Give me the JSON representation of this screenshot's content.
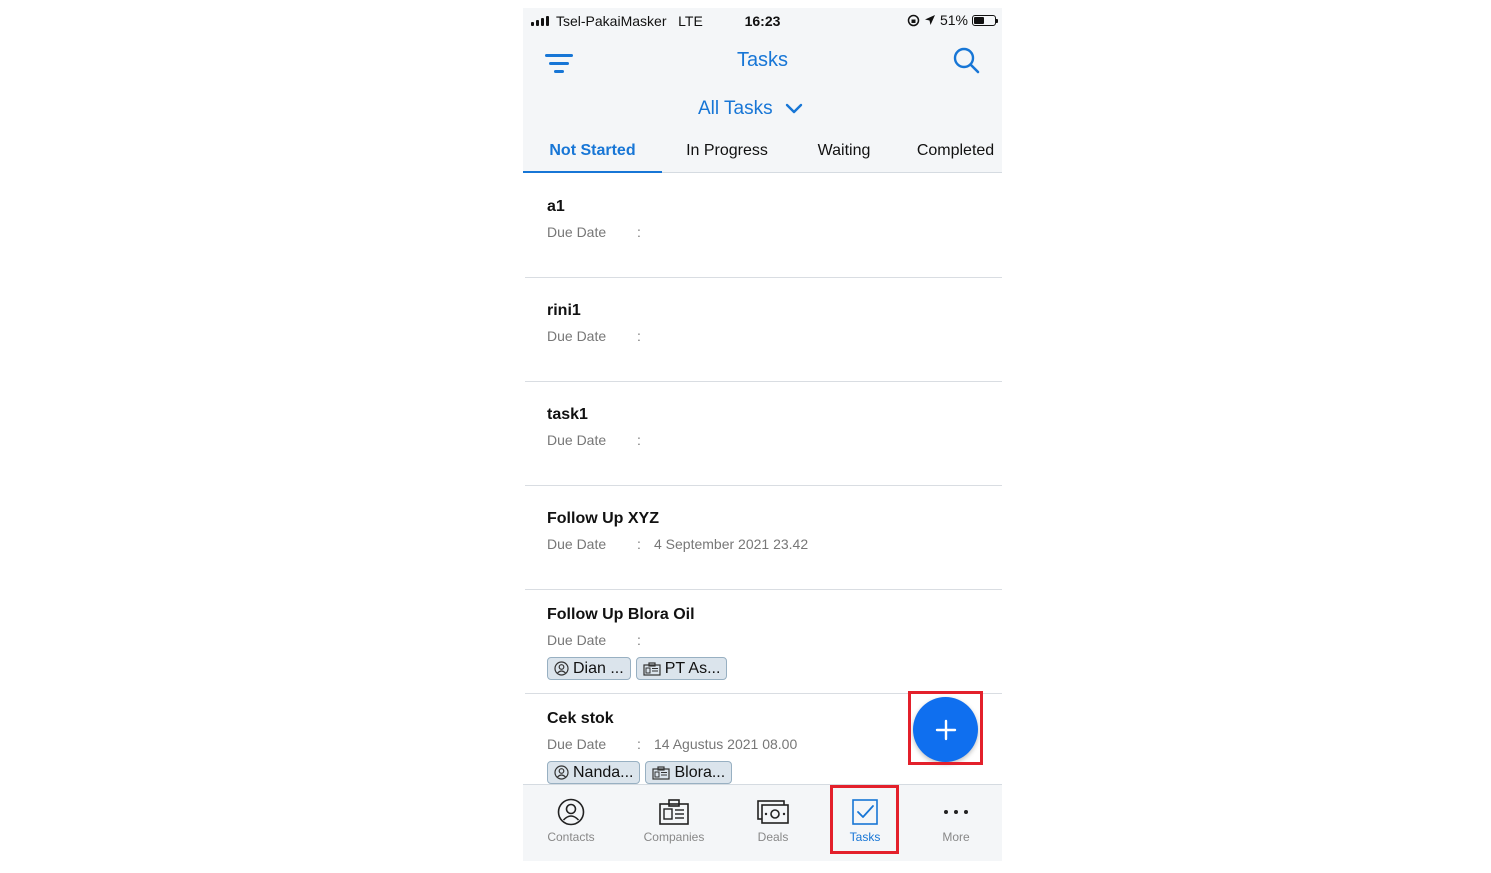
{
  "status_bar": {
    "carrier": "Tsel-PakaiMasker",
    "network": "LTE",
    "time": "16:23",
    "battery": "51%",
    "battery_level": 0.51
  },
  "header": {
    "title": "Tasks",
    "view_selector": "All Tasks",
    "accent_color": "#1776d6"
  },
  "tabs": [
    {
      "label": "Not Started",
      "active": true
    },
    {
      "label": "In Progress",
      "active": false
    },
    {
      "label": "Waiting",
      "active": false
    },
    {
      "label": "Completed",
      "active": false
    }
  ],
  "due_label": "Due Date",
  "due_sep": ":",
  "tasks": [
    {
      "title": "a1",
      "due": ""
    },
    {
      "title": "rini1",
      "due": ""
    },
    {
      "title": "task1",
      "due": ""
    },
    {
      "title": "Follow Up XYZ",
      "due": "4 September 2021 23.42"
    },
    {
      "title": "Follow Up Blora Oil",
      "due": "",
      "contact_tag": "Dian ...",
      "company_tag": "PT As..."
    },
    {
      "title": "Cek stok",
      "due": "14 Agustus 2021 08.00",
      "contact_tag": "Nanda...",
      "company_tag": "Blora..."
    }
  ],
  "fab_icon": "plus-icon",
  "bottom_nav": [
    {
      "label": "Contacts",
      "icon": "contact-icon"
    },
    {
      "label": "Companies",
      "icon": "company-icon"
    },
    {
      "label": "Deals",
      "icon": "deal-icon"
    },
    {
      "label": "Tasks",
      "icon": "task-check-icon",
      "active": true
    },
    {
      "label": "More",
      "icon": "more-icon"
    }
  ],
  "highlight_color": "#e3202b"
}
